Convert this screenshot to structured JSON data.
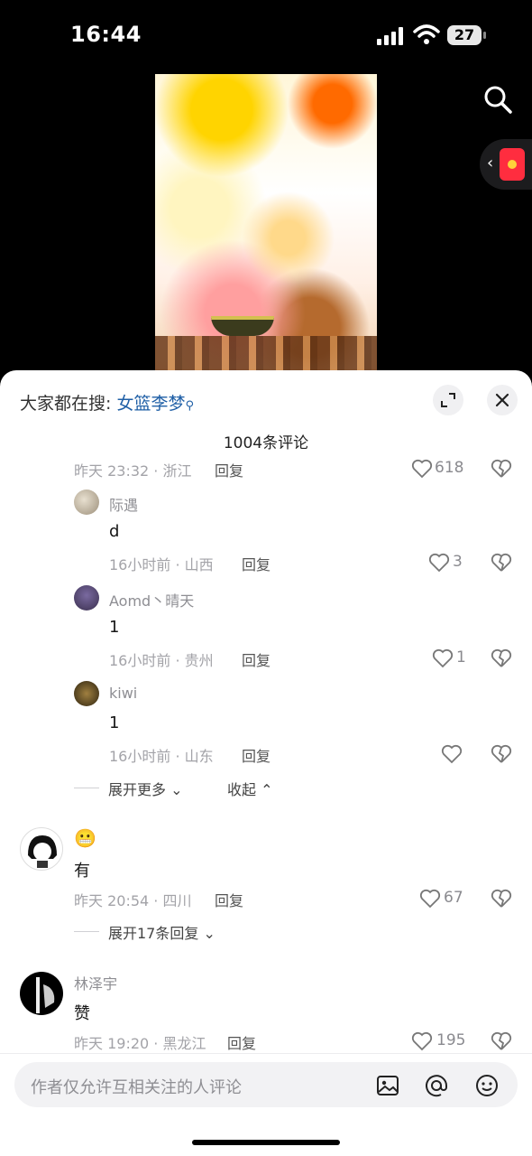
{
  "status_bar": {
    "time": "16:44",
    "battery": "27"
  },
  "sheet": {
    "hot_search_prefix": "大家都在搜:",
    "hot_search_keyword": "女篮李梦",
    "comment_count": "1004条评论"
  },
  "partial_row": {
    "meta": "昨天 23:32 · 浙江",
    "reply": "回复",
    "likes": "618"
  },
  "replies": [
    {
      "name": "际遇",
      "text": "d",
      "meta": "16小时前 · 山西",
      "reply": "回复",
      "likes": "3"
    },
    {
      "name": "Aomd丶晴天",
      "text": "1",
      "meta": "16小时前 · 贵州",
      "reply": "回复",
      "likes": "1"
    },
    {
      "name": "kiwi",
      "text": "1",
      "meta": "16小时前 · 山东",
      "reply": "回复",
      "likes": ""
    }
  ],
  "thread_controls": {
    "expand_more": "展开更多",
    "collapse": "收起"
  },
  "comments": [
    {
      "name": "😬",
      "text": "有",
      "meta": "昨天 20:54 · 四川",
      "reply": "回复",
      "likes": "67",
      "expand": "展开17条回复"
    },
    {
      "name": "林泽宇",
      "text": "赞",
      "meta": "昨天 19:20 · 黑龙江",
      "reply": "回复",
      "likes": "195"
    }
  ],
  "input": {
    "placeholder": "作者仅允许互相关注的人评论"
  },
  "colors": {
    "keyword": "#1f5fa6",
    "red_packet": "#ff2d3f"
  }
}
